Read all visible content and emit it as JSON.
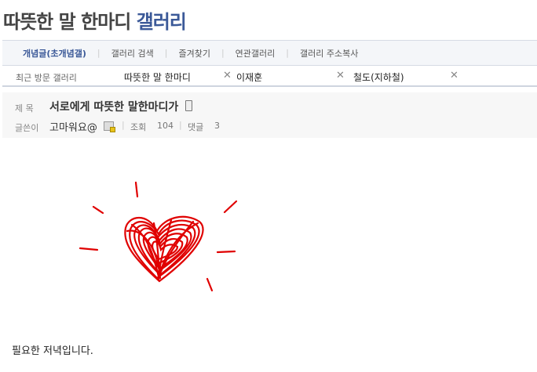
{
  "gallery": {
    "title_prefix": "따뜻한 말 한마디",
    "title_suffix": "갤러리"
  },
  "tabs": [
    "개념글(초개념갤)",
    "갤러리 검색",
    "즐겨찾기",
    "연관갤러리",
    "갤러리 주소복사"
  ],
  "recent": {
    "label": "최근 방문 갤러리",
    "items": [
      "따뜻한 말 한마디",
      "이재훈",
      "철도(지하철)"
    ]
  },
  "post": {
    "subject_label": "제 목",
    "subject": "서로에게 따뜻한 말한마디가",
    "author_label": "글쓴이",
    "author": "고마워요@",
    "views_label": "조회",
    "views": "104",
    "comments_label": "댓글",
    "comments": "3",
    "body": "필요한 저녁입니다."
  },
  "icons": {
    "close": "close-icon",
    "phone": "mobile-phone-icon",
    "author": "user-gallog-icon"
  },
  "colors": {
    "accent": "#3b5998",
    "heart": "#e00000"
  }
}
